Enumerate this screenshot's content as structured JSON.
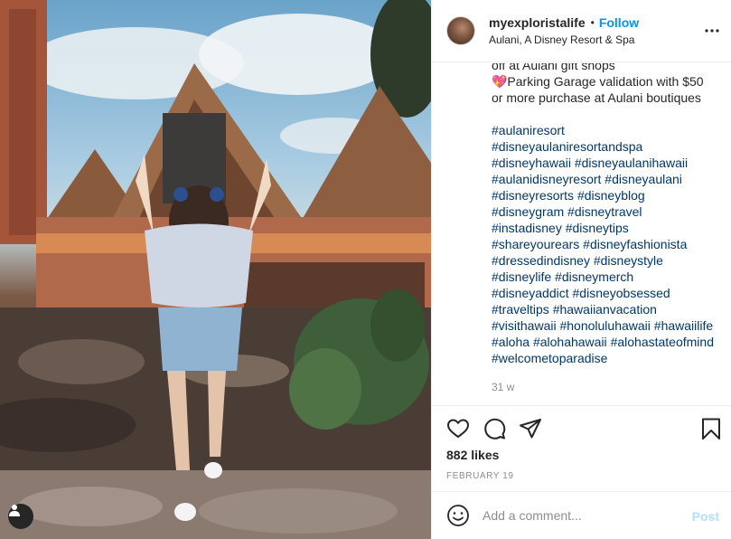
{
  "post": {
    "username": "myexploristalife",
    "separator": "•",
    "follow_label": "Follow",
    "location": "Aulani, A Disney Resort & Spa",
    "caption_lines": [
      "off at Aulani gift shops",
      "💖Parking Garage validation with $50",
      "or more purchase at Aulani boutiques"
    ],
    "hashtag_lines": [
      [
        "#aulaniresort"
      ],
      [
        "#disneyaulaniresortandspa"
      ],
      [
        "#disneyhawaii",
        "#disneyaulanihawaii"
      ],
      [
        "#aulanidisneyresort",
        "#disneyaulani"
      ],
      [
        "#disneyresorts",
        "#disneyblog"
      ],
      [
        "#disneygram",
        "#disneytravel"
      ],
      [
        "#instadisney",
        "#disneytips"
      ],
      [
        "#shareyourears",
        "#disneyfashionista"
      ],
      [
        "#dressedindisney",
        "#disneystyle"
      ],
      [
        "#disneylife",
        "#disneymerch"
      ],
      [
        "#disneyaddict",
        "#disneyobsessed"
      ],
      [
        "#traveltips",
        "#hawaiianvacation"
      ],
      [
        "#visithawaii",
        "#honoluluhawaii",
        "#hawaiilife"
      ],
      [
        "#aloha",
        "#alohahawaii",
        "#alohastateofmind"
      ],
      [
        "#welcometoparadise"
      ]
    ],
    "time_ago": "31 w",
    "likes": "882 likes",
    "date": "FEBRUARY 19"
  },
  "comment": {
    "placeholder": "Add a comment...",
    "post_label": "Post"
  },
  "icons": {
    "more": "more-options-icon",
    "like": "heart-icon",
    "comment": "comment-icon",
    "share": "paper-plane-icon",
    "save": "bookmark-icon",
    "emoji": "smiley-icon",
    "user_tag": "person-icon"
  },
  "colors": {
    "accent": "#0095f6",
    "hashtag": "#00376b",
    "muted": "#8e8e8e",
    "post_disabled": "#b2dffc",
    "divider": "#efefef"
  }
}
